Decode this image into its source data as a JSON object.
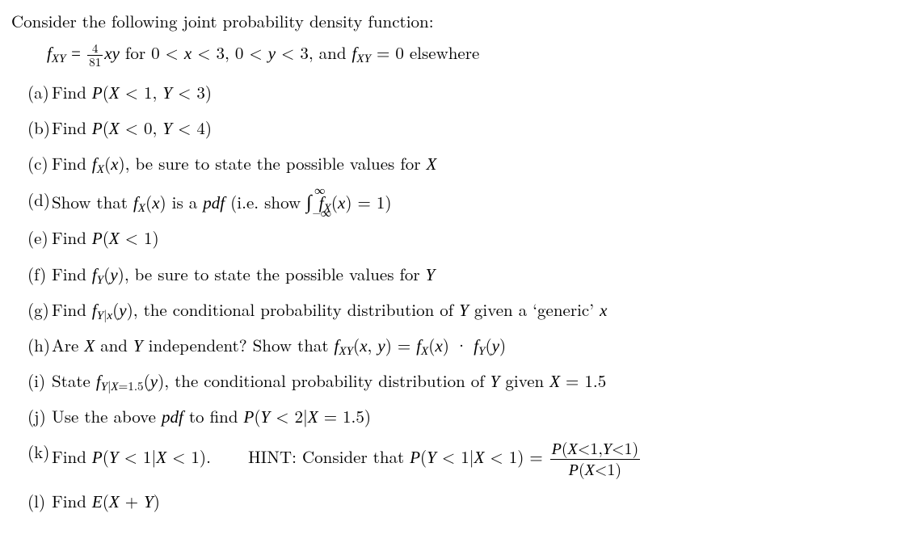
{
  "intro": "Consider the following joint probability density function:",
  "pdf_line": {
    "lhs": "f<sub class=\"mi\">XY</sub> = ",
    "frac_num": "4",
    "frac_den": "81",
    "mid": "<span class=\"mi\">xy</span> for 0 &lt; <span class=\"mi\">x</span> &lt; 3, 0 &lt; <span class=\"mi\">y</span> &lt; 3, and ",
    "rhs": "<span class=\"mi\">f</span><sub class=\"mi\">XY</sub> = 0 elsewhere"
  },
  "parts": [
    {
      "marker": "(a)",
      "body": "Find <span class=\"mi\">P</span>(<span class=\"mi\">X</span> &lt; 1, <span class=\"mi\">Y</span> &lt; 3)"
    },
    {
      "marker": "(b)",
      "body": "Find <span class=\"mi\">P</span>(<span class=\"mi\">X</span> &lt; 0, <span class=\"mi\">Y</span> &lt; 4)"
    },
    {
      "marker": "(c)",
      "body": "Find <span class=\"mi\">f</span><sub class=\"mi\">X</sub>(<span class=\"mi\">x</span>), be sure to state the possible values for <span class=\"mi\">X</span>"
    },
    {
      "marker": "(d)",
      "body": "Show that <span class=\"mi\">f</span><sub class=\"mi\">X</sub>(<span class=\"mi\">x</span>) is a <span class=\"mi\">pdf</span> (i.e. show <span class=\"intsym\">∫<span class=\"ub\">∞</span><span class=\"lb\">−∞</span></span> <span class=\"mi\">f</span><sub class=\"mi\">X</sub>(<span class=\"mi\">x</span>) = 1)"
    },
    {
      "marker": "(e)",
      "body": "Find <span class=\"mi\">P</span>(<span class=\"mi\">X</span> &lt; 1)"
    },
    {
      "marker": "(f)",
      "body": "Find <span class=\"mi\">f</span><sub class=\"mi\">Y</sub>(<span class=\"mi\">y</span>), be sure to state the possible values for <span class=\"mi\">Y</span>"
    },
    {
      "marker": "(g)",
      "body": "Find <span class=\"mi\">f</span><sub><span class=\"mi\">Y</span>|<span class=\"mi\">x</span></sub>(<span class=\"mi\">y</span>), the conditional probability distribution of <span class=\"mi\">Y</span> given a ‘generic’ <span class=\"mi\">x</span>"
    },
    {
      "marker": "(h)",
      "body": "Are <span class=\"mi\">X</span> and <span class=\"mi\">Y</span> independent? Show that <span class=\"mi\">f</span><sub class=\"mi\">XY</sub>(<span class=\"mi\">x</span>, <span class=\"mi\">y</span>) = <span class=\"mi\">f</span><sub class=\"mi\">X</sub>(<span class=\"mi\">x</span>) · <span class=\"mi\">f</span><sub class=\"mi\">Y</sub>(<span class=\"mi\">y</span>)"
    },
    {
      "marker": "(i)",
      "body": "State <span class=\"mi\">f</span><sub><span class=\"mi\">Y</span>|<span class=\"mi\">X</span>=1.5</sub>(<span class=\"mi\">y</span>), the conditional probability distribution of <span class=\"mi\">Y</span> given <span class=\"mi\">X</span> = 1.5"
    },
    {
      "marker": "(j)",
      "body": "Use the above <span class=\"mi\">pdf</span> to find <span class=\"mi\">P</span>(<span class=\"mi\">Y</span> &lt; 2|<span class=\"mi\">X</span> = 1.5)"
    },
    {
      "marker": "(k)",
      "body_html": true,
      "body": "Find <span class=\"mi\">P</span>(<span class=\"mi\">Y</span> &lt; 1|<span class=\"mi\">X</span> &lt; 1).<span class=\"hint\">HINT: Consider that <span class=\"mi\">P</span>(<span class=\"mi\">Y</span> &lt; 1|<span class=\"mi\">X</span> &lt; 1) = <span class=\"frac fracbig\"><span class=\"num\"><span class=\"mi\">P</span>(<span class=\"mi\">X</span>&lt;1,<span class=\"mi\">Y</span>&lt;1)</span><span class=\"den\"><span class=\"mi\">P</span>(<span class=\"mi\">X</span>&lt;1)</span></span></span>"
    },
    {
      "marker": "(l)",
      "body": "Find <span class=\"mi\">E</span>(<span class=\"mi\">X</span> + <span class=\"mi\">Y</span>)"
    }
  ]
}
